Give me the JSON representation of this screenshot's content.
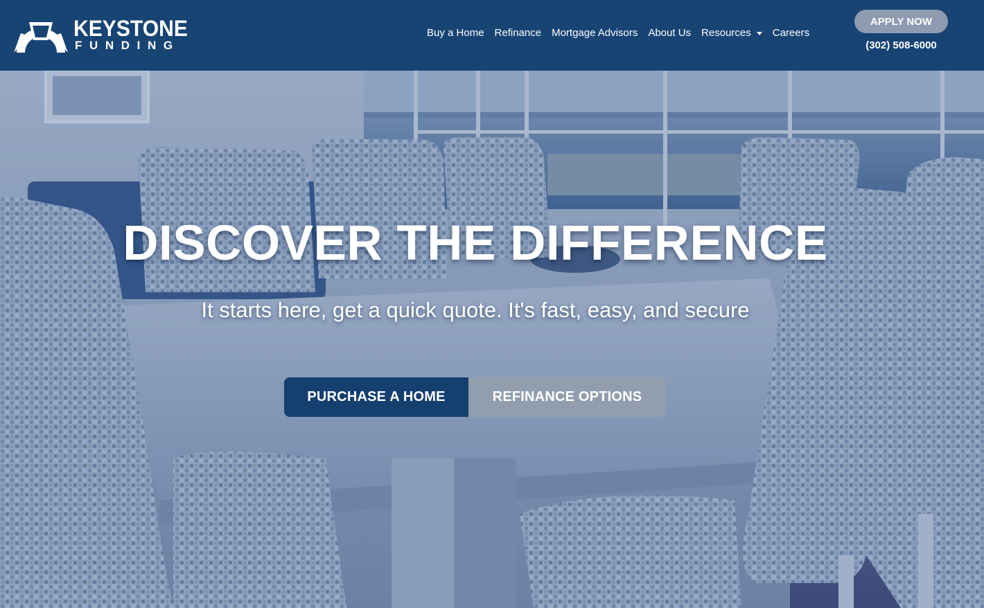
{
  "brand": {
    "name_line1": "KEYSTONE",
    "name_line2": "FUNDING",
    "logo_icon": "keystone-arch-icon"
  },
  "nav": {
    "items": [
      {
        "label": "Buy a Home"
      },
      {
        "label": "Refinance"
      },
      {
        "label": "Mortgage Advisors"
      },
      {
        "label": "About Us"
      },
      {
        "label": "Resources",
        "has_dropdown": true
      },
      {
        "label": "Careers"
      }
    ]
  },
  "header": {
    "apply_label": "APPLY NOW",
    "phone": "(302) 508-6000"
  },
  "hero": {
    "title": "DISCOVER THE DIFFERENCE",
    "subtitle": "It starts here, get a quick quote. It's fast, easy, and secure",
    "primary_button": "PURCHASE A HOME",
    "secondary_button": "REFINANCE OPTIONS",
    "background": "dining room with patterned chairs and ocean view, blue tint"
  },
  "colors": {
    "header_bg": "#174473",
    "primary_button": "#153f6f",
    "secondary_button": "#929ead",
    "apply_button": "#8e9bb0",
    "text": "#ffffff"
  }
}
